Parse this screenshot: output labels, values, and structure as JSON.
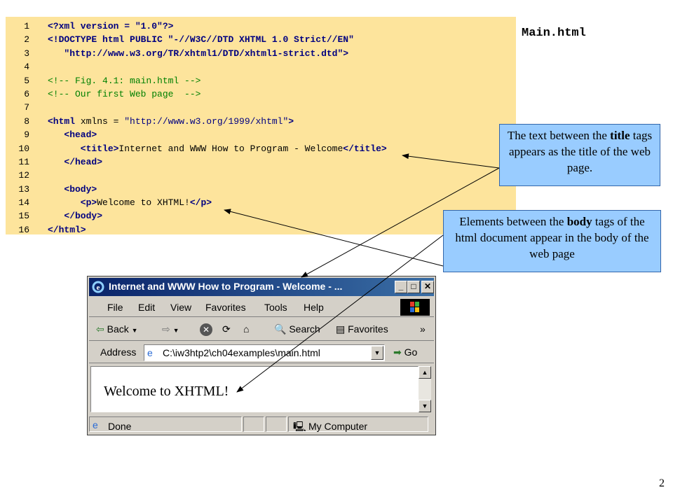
{
  "code": {
    "lines": [
      {
        "num": "1",
        "parts": [
          {
            "t": "<?xml version = \"1.0\"?>",
            "c": "tag"
          }
        ]
      },
      {
        "num": "2",
        "parts": [
          {
            "t": "<!DOCTYPE html PUBLIC \"-//W3C//DTD XHTML 1.0 Strict//EN\"",
            "c": "tag"
          }
        ]
      },
      {
        "num": "3",
        "parts": [
          {
            "t": "   \"http://www.w3.org/TR/xhtml1/DTD/xhtml1-strict.dtd\">",
            "c": "tag"
          }
        ]
      },
      {
        "num": "4",
        "parts": []
      },
      {
        "num": "5",
        "parts": [
          {
            "t": "<!-- Fig. 4.1: main.html -->",
            "c": "com"
          }
        ]
      },
      {
        "num": "6",
        "parts": [
          {
            "t": "<!-- Our first Web page  -->",
            "c": "com"
          }
        ]
      },
      {
        "num": "7",
        "parts": []
      },
      {
        "num": "8",
        "parts": [
          {
            "t": "<html ",
            "c": "tag"
          },
          {
            "t": "xmlns = ",
            "c": "attr"
          },
          {
            "t": "\"http://www.w3.org/1999/xhtml\"",
            "c": "str"
          },
          {
            "t": ">",
            "c": "tag"
          }
        ]
      },
      {
        "num": "9",
        "parts": [
          {
            "t": "   <head>",
            "c": "tag"
          }
        ]
      },
      {
        "num": "10",
        "parts": [
          {
            "t": "      <title>",
            "c": "tag"
          },
          {
            "t": "Internet and WWW How to Program - Welcome",
            "c": "txt"
          },
          {
            "t": "</title>",
            "c": "tag"
          }
        ]
      },
      {
        "num": "11",
        "parts": [
          {
            "t": "   </head>",
            "c": "tag"
          }
        ]
      },
      {
        "num": "12",
        "parts": []
      },
      {
        "num": "13",
        "parts": [
          {
            "t": "   <body>",
            "c": "tag"
          }
        ]
      },
      {
        "num": "14",
        "parts": [
          {
            "t": "      <p>",
            "c": "tag"
          },
          {
            "t": "Welcome to XHTML!",
            "c": "txt"
          },
          {
            "t": "</p>",
            "c": "tag"
          }
        ]
      },
      {
        "num": "15",
        "parts": [
          {
            "t": "   </body>",
            "c": "tag"
          }
        ]
      },
      {
        "num": "16",
        "parts": [
          {
            "t": "</html>",
            "c": "tag"
          }
        ]
      }
    ]
  },
  "file_title": "Main.html",
  "callout_title": {
    "pre": "The text between the ",
    "bold": "title",
    "post": " tags appears as the title of the web page."
  },
  "callout_body": {
    "pre": "Elements between the ",
    "bold": "body",
    "post": " tags of the html document appear in the body of the web page"
  },
  "browser": {
    "window_title": "Internet and WWW How to Program - Welcome - ...",
    "menu": [
      "File",
      "Edit",
      "View",
      "Favorites",
      "Tools",
      "Help"
    ],
    "toolbar": {
      "back": "Back",
      "search": "Search",
      "favorites": "Favorites"
    },
    "address_label": "Address",
    "address_value": "C:\\iw3htp2\\ch04examples\\main.html",
    "go_label": "Go",
    "content_text": "Welcome to XHTML!",
    "status_left": "Done",
    "status_right": "My Computer"
  },
  "page_number": "2",
  "colors": {
    "code_bg": "#fde49c",
    "callout_bg": "#99ccff",
    "titlebar": "#0a246a"
  }
}
